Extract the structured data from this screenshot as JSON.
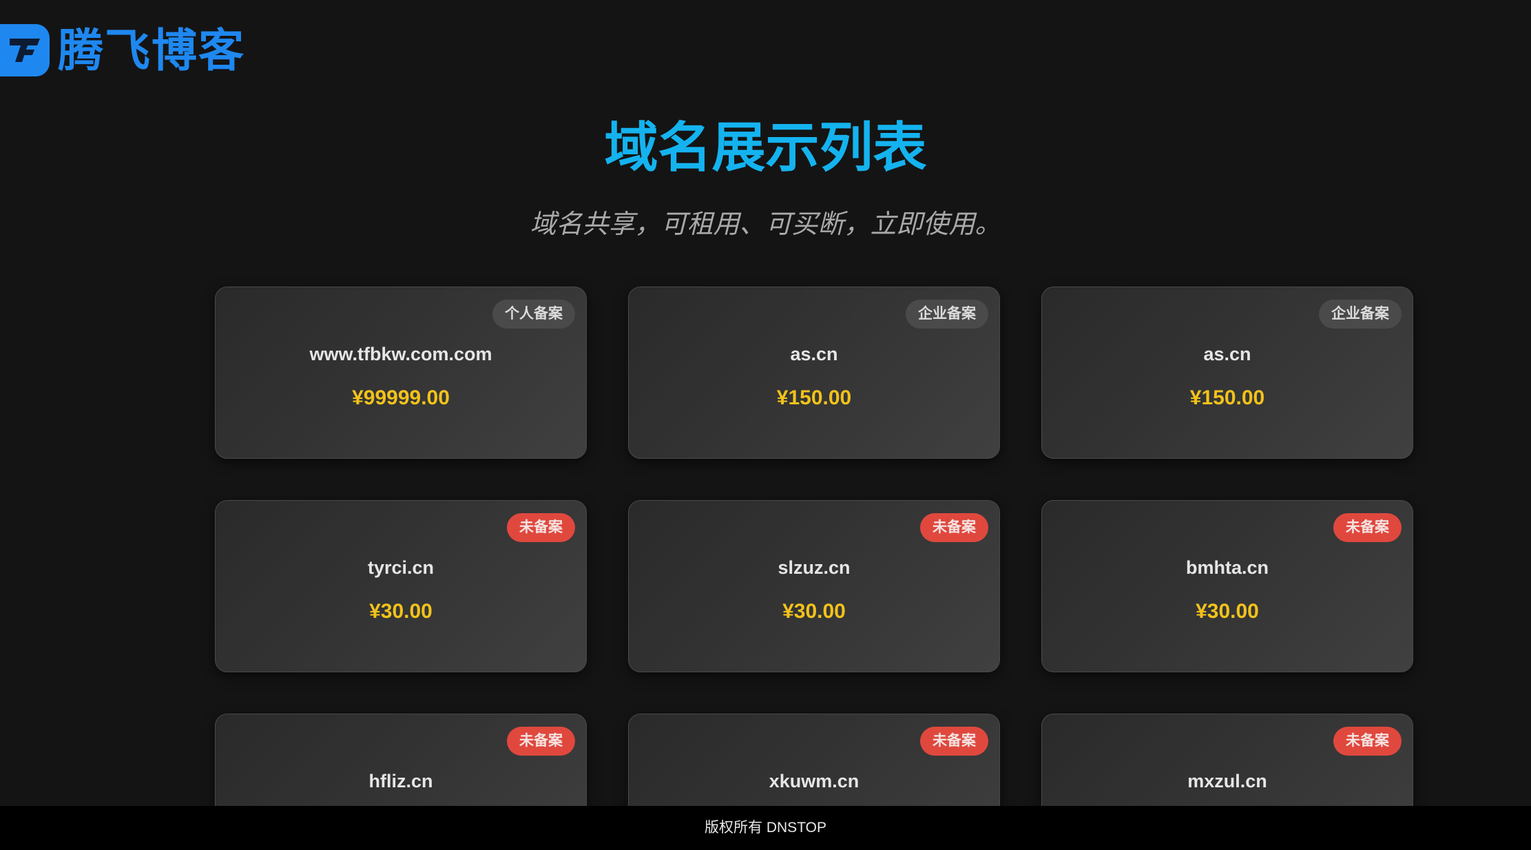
{
  "logo": {
    "text": "腾飞博客"
  },
  "heading": {
    "title": "域名展示列表",
    "subtitle": "域名共享，可租用、可买断，立即使用。"
  },
  "colors": {
    "accent": "#14b3ef",
    "brand": "#1e88f0",
    "price": "#f2c21b",
    "badge_unfiled": "#e0483e",
    "badge_filed": "#4a4a4a"
  },
  "domains": [
    {
      "name": "www.tfbkw.com.com",
      "price": "¥99999.00",
      "badge": "个人备案",
      "status": "filed"
    },
    {
      "name": "as.cn",
      "price": "¥150.00",
      "badge": "企业备案",
      "status": "filed"
    },
    {
      "name": "as.cn",
      "price": "¥150.00",
      "badge": "企业备案",
      "status": "filed"
    },
    {
      "name": "tyrci.cn",
      "price": "¥30.00",
      "badge": "未备案",
      "status": "none"
    },
    {
      "name": "slzuz.cn",
      "price": "¥30.00",
      "badge": "未备案",
      "status": "none"
    },
    {
      "name": "bmhta.cn",
      "price": "¥30.00",
      "badge": "未备案",
      "status": "none"
    },
    {
      "name": "hfliz.cn",
      "price": "",
      "badge": "未备案",
      "status": "none"
    },
    {
      "name": "xkuwm.cn",
      "price": "",
      "badge": "未备案",
      "status": "none"
    },
    {
      "name": "mxzul.cn",
      "price": "",
      "badge": "未备案",
      "status": "none"
    }
  ],
  "footer": {
    "text": "版权所有 DNSTOP"
  }
}
